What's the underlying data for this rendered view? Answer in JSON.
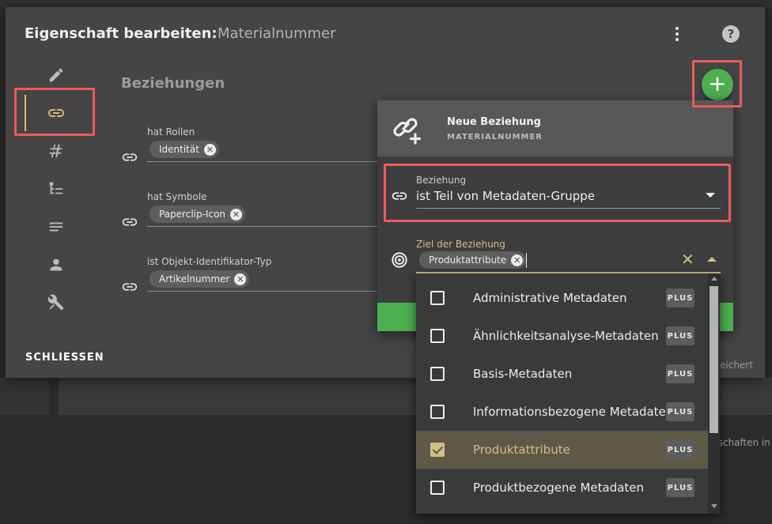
{
  "dialog": {
    "title": "Eigenschaft bearbeiten:",
    "subtitle": "Materialnummer",
    "section_title": "Beziehungen",
    "close_label": "SCHLIESSEN",
    "saved_text": "eichert"
  },
  "sidebar": {
    "items": [
      {
        "icon": "pencil-icon"
      },
      {
        "icon": "link-icon",
        "active": true
      },
      {
        "icon": "hash-icon"
      },
      {
        "icon": "hierarchy-icon"
      },
      {
        "icon": "text-lines-icon"
      },
      {
        "icon": "person-icon"
      },
      {
        "icon": "tools-icon"
      }
    ]
  },
  "relations": [
    {
      "label": "hat Rollen",
      "chip": "Identität"
    },
    {
      "label": "hat Symbole",
      "chip": "Paperclip-Icon"
    },
    {
      "label": "ist Objekt-Identifikator-Typ",
      "chip": "Artikelnummer"
    }
  ],
  "popup": {
    "title": "Neue Beziehung",
    "subtitle": "MATERIALNUMMER",
    "relation_label": "Beziehung",
    "relation_value": "ist Teil von Metadaten-Gruppe",
    "target_label": "Ziel der Beziehung",
    "target_chip": "Produktattribute"
  },
  "dropdown": {
    "options": [
      {
        "label": "Administrative Metadaten",
        "badge": "PLUS",
        "checked": false
      },
      {
        "label": "Ähnlichkeitsanalyse-Metadaten",
        "badge": "PLUS",
        "checked": false
      },
      {
        "label": "Basis-Metadaten",
        "badge": "PLUS",
        "checked": false
      },
      {
        "label": "Informationsbezogene Metadaten",
        "badge": "PLUS",
        "checked": false
      },
      {
        "label": "Produktattribute",
        "badge": "PLUS",
        "checked": true
      },
      {
        "label": "Produktbezogene Metadaten",
        "badge": "PLUS",
        "checked": false
      }
    ]
  },
  "background": {
    "hint_text": "nschaften in"
  },
  "colors": {
    "accent_gold": "#d4bd83",
    "primary_green": "#4caf50",
    "highlight_red": "#ef5a5a",
    "dialog_bg": "#454545"
  }
}
